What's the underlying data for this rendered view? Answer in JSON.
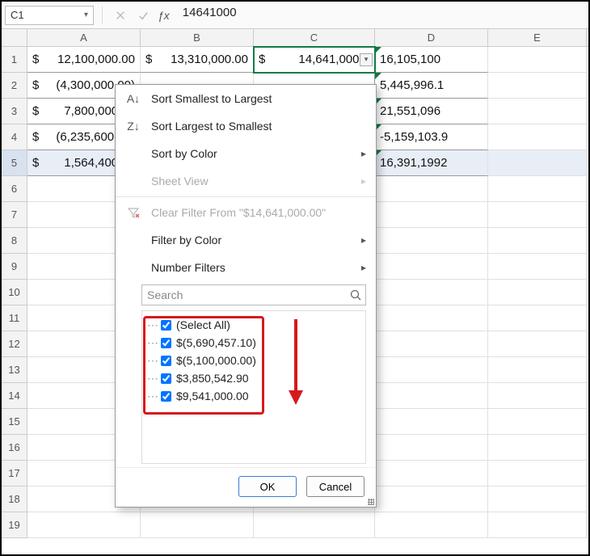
{
  "namebox": "C1",
  "formula_value": "14641000",
  "columns": [
    "A",
    "B",
    "C",
    "D",
    "E"
  ],
  "row_numbers": [
    1,
    2,
    3,
    4,
    5,
    6,
    7,
    8,
    9,
    10,
    11,
    12,
    13,
    14,
    15,
    16,
    17,
    18,
    19
  ],
  "cells": {
    "r1": {
      "A": "12,100,000.00",
      "B": "13,310,000.00",
      "C": "14,641,000.0",
      "D": "16,105,100"
    },
    "r2": {
      "A": "(4,300,000.00)",
      "D": "5,445,996.1"
    },
    "r3": {
      "A": "7,800,000.00",
      "D": "21,551,096"
    },
    "r4": {
      "A": "(6,235,600.00)",
      "D": "-5,159,103.9"
    },
    "r5": {
      "A": "1,564,400.00",
      "D": "16,391,1992"
    }
  },
  "menu": {
    "sort_asc": "Sort Smallest to Largest",
    "sort_desc": "Sort Largest to Smallest",
    "sort_color": "Sort by Color",
    "sheet_view": "Sheet View",
    "clear_filter": "Clear Filter From \"$14,641,000.00\"",
    "filter_color": "Filter by Color",
    "number_filters": "Number Filters",
    "search_placeholder": "Search",
    "ok": "OK",
    "cancel": "Cancel"
  },
  "filter_items": [
    "(Select All)",
    "$(5,690,457.10)",
    "$(5,100,000.00)",
    "$3,850,542.90",
    "$9,541,000.00"
  ]
}
